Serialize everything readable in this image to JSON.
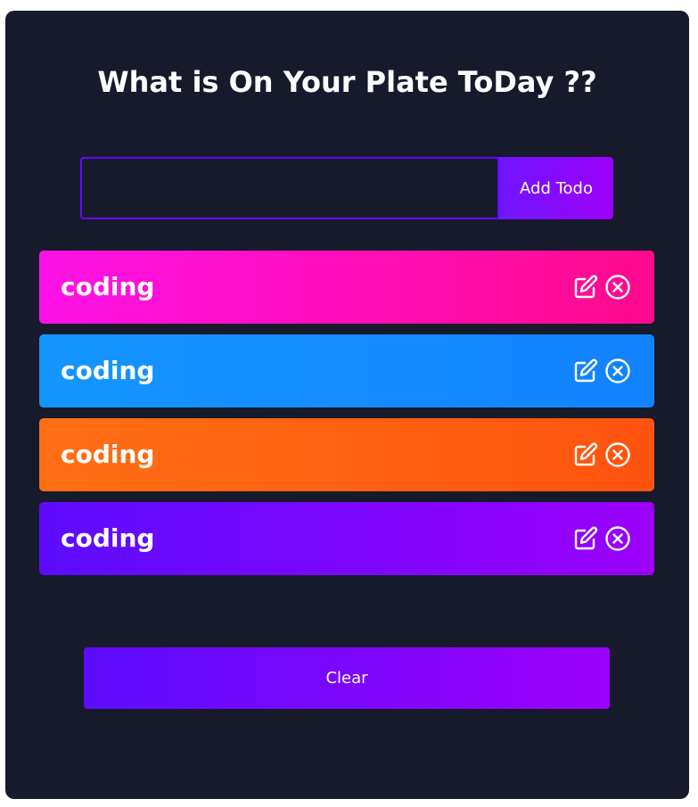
{
  "app": {
    "title": "What is On Your Plate ToDay ??"
  },
  "form": {
    "input_value": "",
    "input_placeholder": "",
    "add_label": "Add Todo"
  },
  "todos": [
    {
      "text": "coding",
      "color_start": "#ff12e7",
      "color_end": "#ff0a8c"
    },
    {
      "text": "coding",
      "color_start": "#1496ff",
      "color_end": "#1282ff"
    },
    {
      "text": "coding",
      "color_start": "#ff6f14",
      "color_end": "#ff530f"
    },
    {
      "text": "coding",
      "color_start": "#5d0cff",
      "color_end": "#9b00fa"
    }
  ],
  "actions": {
    "edit_icon": "edit-icon",
    "delete_icon": "close-circle-icon"
  },
  "footer": {
    "clear_label": "Clear"
  },
  "colors": {
    "background": "#161a2b",
    "accent_start": "#5d0cff",
    "accent_end": "#9b00fa"
  }
}
